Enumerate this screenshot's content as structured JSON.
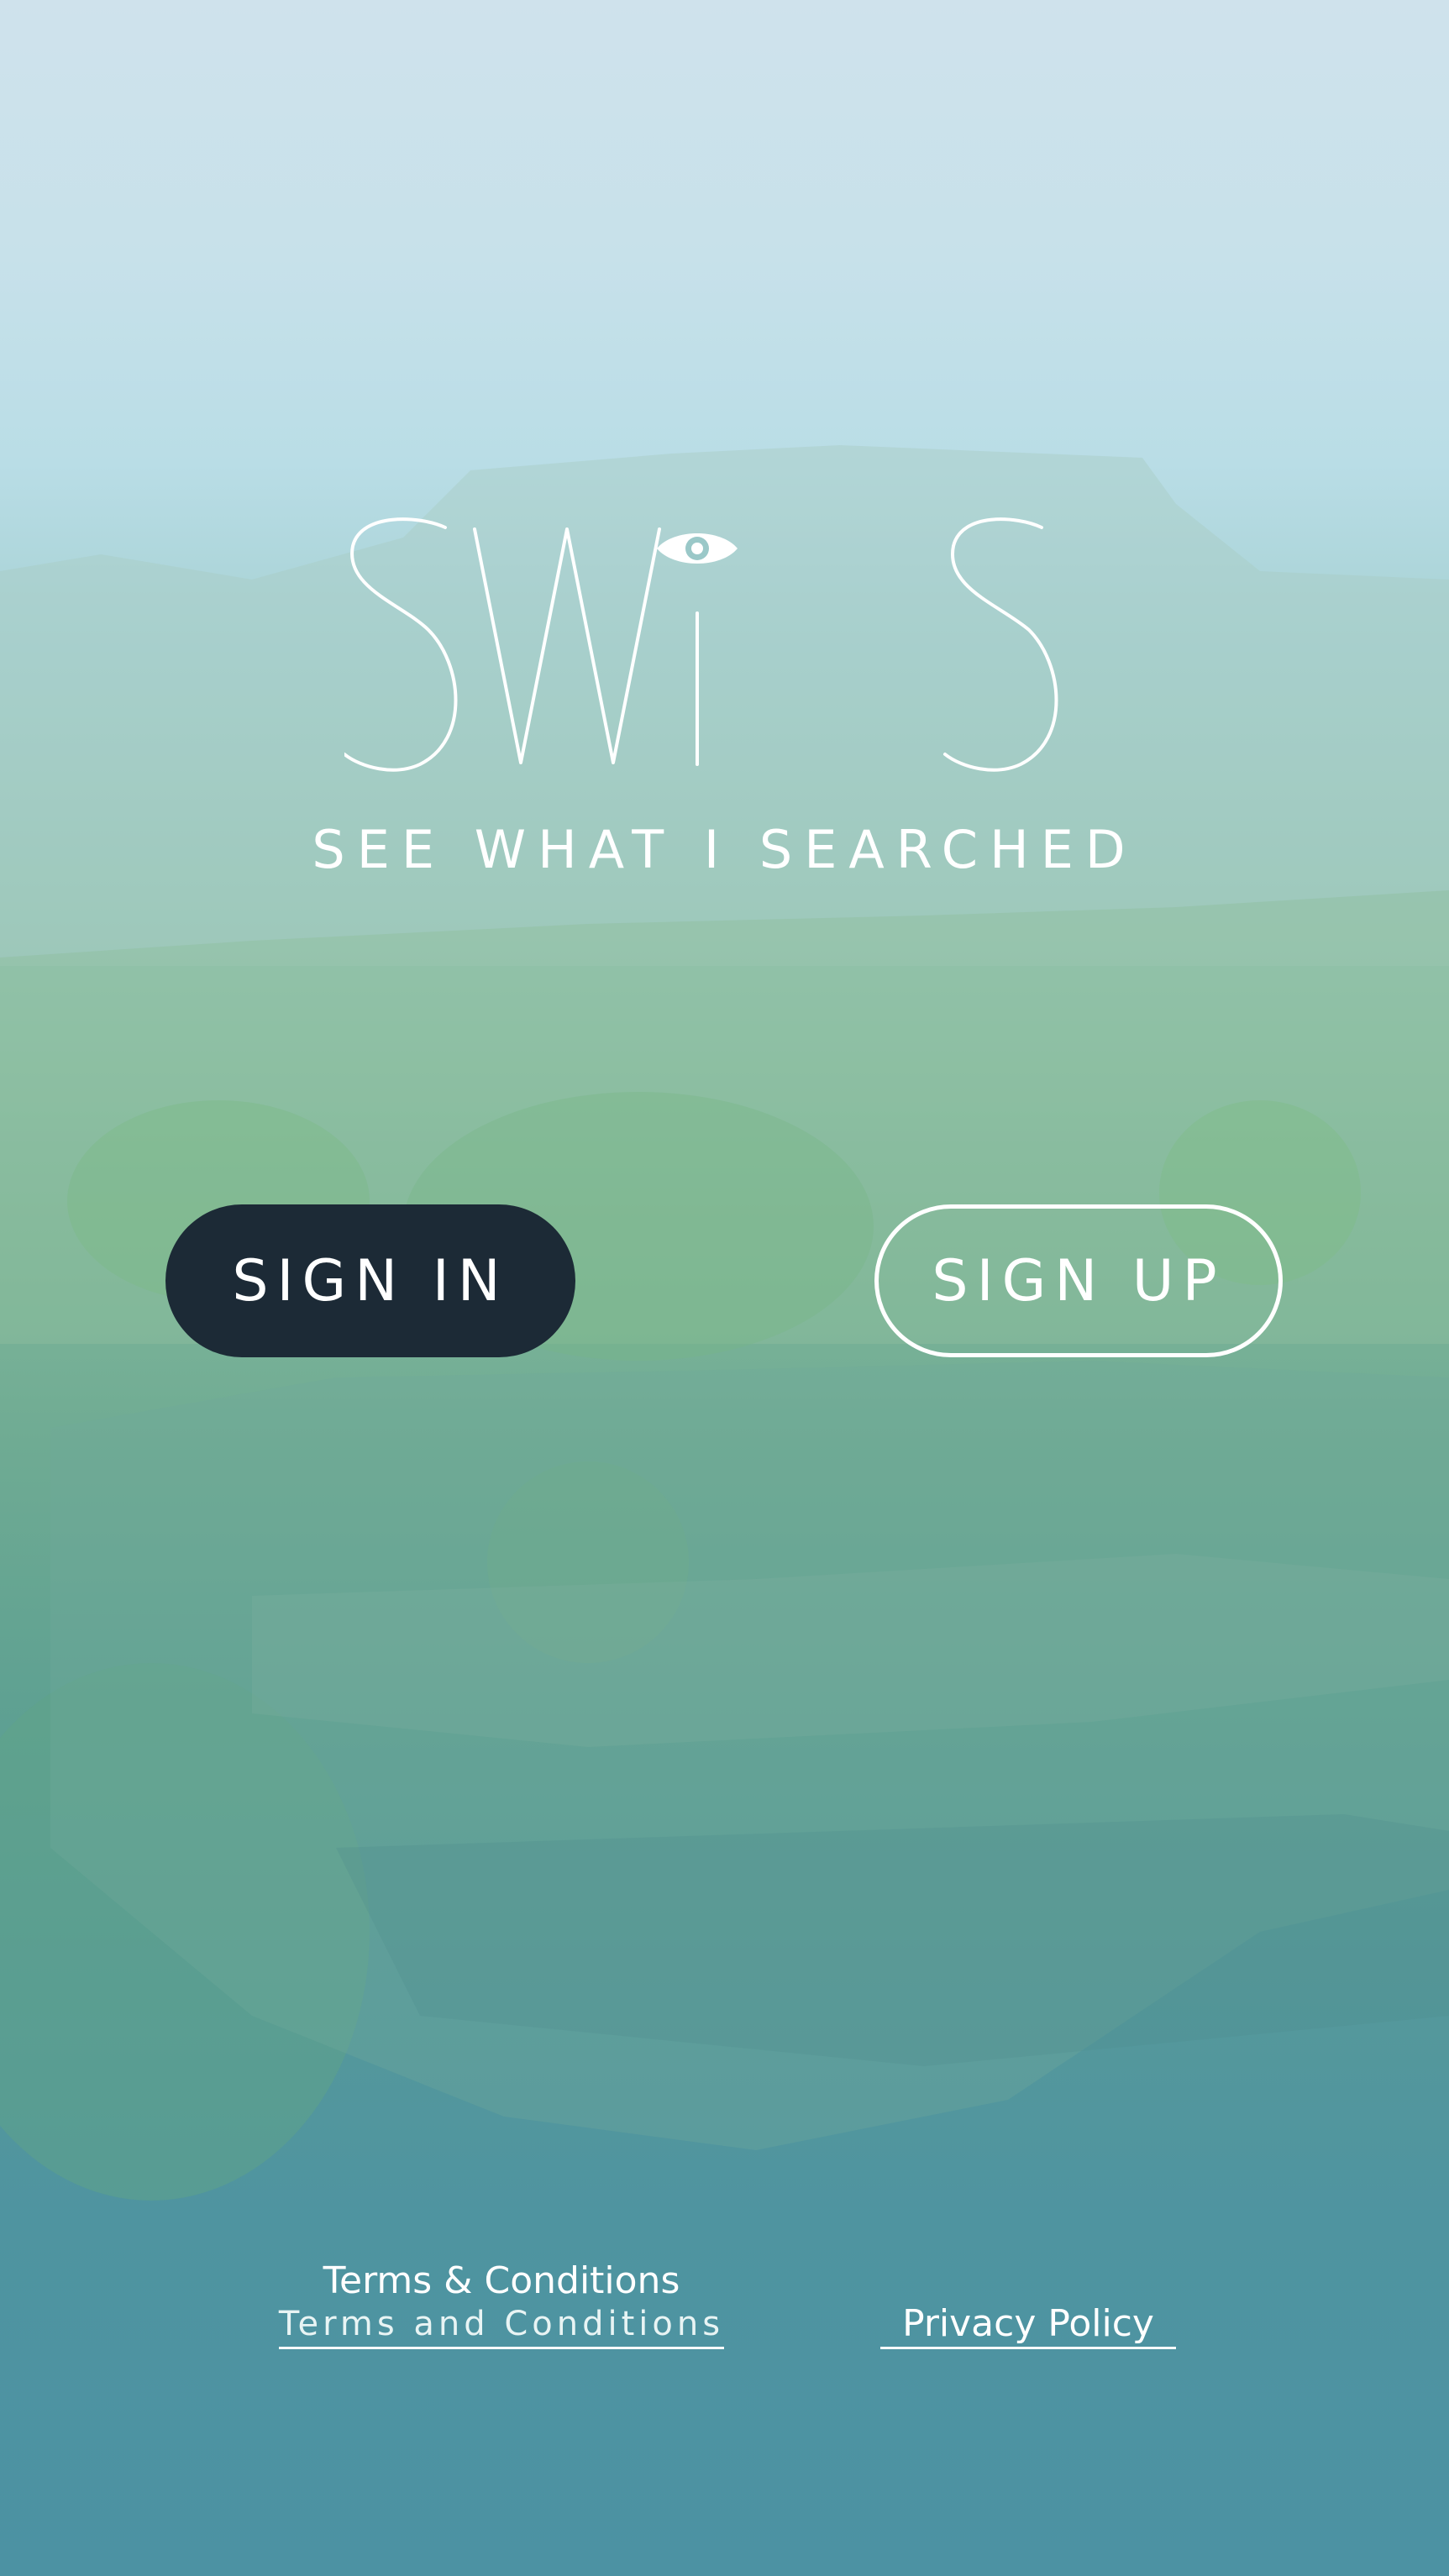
{
  "brand": {
    "logo_text": "SWiS",
    "tagline": "SEE WHAT I SEARCHED"
  },
  "actions": {
    "sign_in_label": "SIGN IN",
    "sign_up_label": "SIGN UP"
  },
  "legal": {
    "terms_title": "Terms & Conditions",
    "terms_link": "Terms and Conditions",
    "privacy_link": "Privacy Policy"
  },
  "icons": [
    "eye-icon"
  ],
  "colors": {
    "sign_in_bg": "#1c2a36",
    "text": "#ffffff",
    "sky": "#c7e1ea",
    "foliage": "#7fb69a",
    "base": "#4c92a3"
  }
}
